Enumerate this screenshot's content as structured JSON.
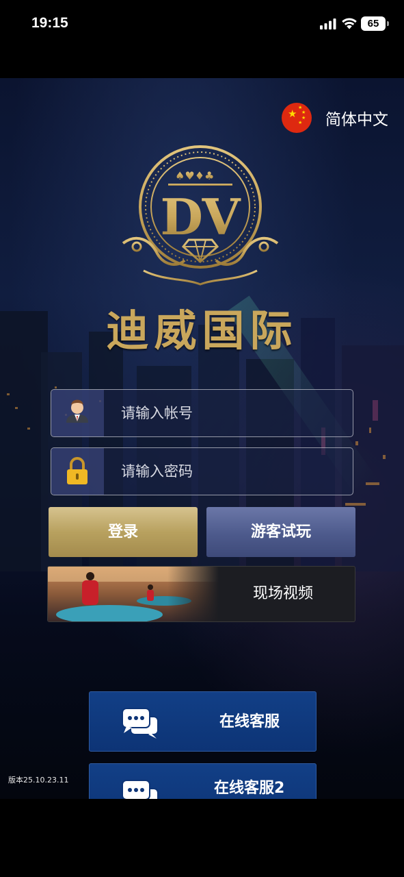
{
  "status_bar": {
    "time": "19:15",
    "battery": "65"
  },
  "language": {
    "label": "简体中文",
    "flag_icon": "china-flag-icon"
  },
  "brand": {
    "logo_letters": "DV",
    "title": "迪威国际"
  },
  "login_form": {
    "username_placeholder": "请输入帐号",
    "password_placeholder": "请输入密码"
  },
  "buttons": {
    "login": "登录",
    "guest": "游客试玩",
    "live_video": "现场视频"
  },
  "support": {
    "primary": "在线客服",
    "secondary": "在线客服2"
  },
  "version": "版本25.10.23.11",
  "colors": {
    "gold": "#c9a75c",
    "login_button": "#b8a15f",
    "guest_button": "#4d5a8c",
    "support_button": "#0d3476"
  }
}
